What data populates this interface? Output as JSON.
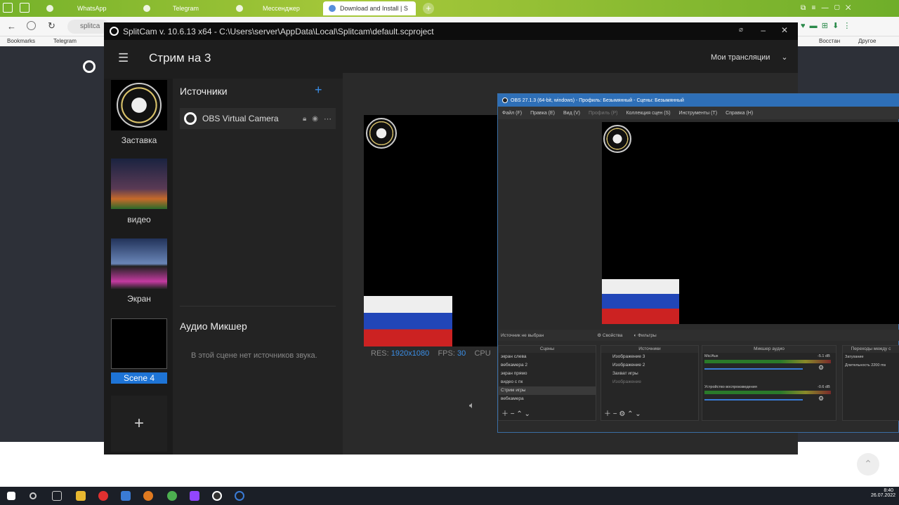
{
  "browser": {
    "tabs": [
      {
        "label": "WhatsApp",
        "active": false
      },
      {
        "label": "Telegram",
        "active": false
      },
      {
        "label": "Мессенджер",
        "active": false
      },
      {
        "label": "Download and Install | S",
        "active": true
      }
    ],
    "address": "splitca",
    "bookmarks": [
      "Bookmarks",
      "Telegram"
    ],
    "bookmarks_right": [
      "Восстан",
      "Другое"
    ]
  },
  "splitcam": {
    "title": "SplitCam v. 10.6.13 x64 - C:\\Users\\server\\AppData\\Local\\Splitcam\\default.scproject",
    "stream_title": "Стрим на 3",
    "my_streams": "Мои трансляции",
    "scenes": [
      {
        "label": "Заставка",
        "selected": false
      },
      {
        "label": "видео",
        "selected": false
      },
      {
        "label": "Экран",
        "selected": false
      },
      {
        "label": "Scene 4",
        "selected": true
      }
    ],
    "sources_heading": "Источники",
    "sources": [
      {
        "label": "OBS Virtual Camera"
      }
    ],
    "audio_mixer_heading": "Аудио Микшер",
    "audio_empty": "В этой сцене нет источников звука.",
    "stats": {
      "res_label": "RES:",
      "res": "1920x1080",
      "fps_label": "FPS:",
      "fps": "30",
      "cpu": "CPU"
    }
  },
  "obs": {
    "title": "OBS 27.1.3 (64-bit, windows) - Профиль: Безымянный - Сцены: Безымянный",
    "menu": [
      "Файл (F)",
      "Правка (E)",
      "Вид (V)",
      "Профиль (P)",
      "Коллекция сцен (S)",
      "Инструменты (T)",
      "Справка (H)"
    ],
    "source_bar": {
      "none_selected": "Источник не выбран",
      "properties": "Свойства",
      "filters": "Фильтры"
    },
    "docks": {
      "scenes_header": "Сцены",
      "scenes": [
        "экран слева",
        "вебкамера 2",
        "экран прямо",
        "видео с пк",
        "Стрим игры",
        "вебкамера"
      ],
      "sources_header": "Источники",
      "sources": [
        "Изображение 3",
        "Изображение 2",
        "Захват игры",
        "Изображение"
      ],
      "mixer_header": "Микшер аудио",
      "mixer": [
        {
          "name": "Mic/Aux",
          "db": "-5.1 dB",
          "volume": 0.8
        },
        {
          "name": "Устройство воспроизведения",
          "db": "-0.6 dB",
          "volume": 0.9
        }
      ],
      "transitions_header": "Переходы между с",
      "transition": "Затухание",
      "duration_label": "Длительность",
      "duration": "2200 ms"
    }
  },
  "taskbar": {
    "time": "8:40",
    "date": "26.07.2022"
  }
}
